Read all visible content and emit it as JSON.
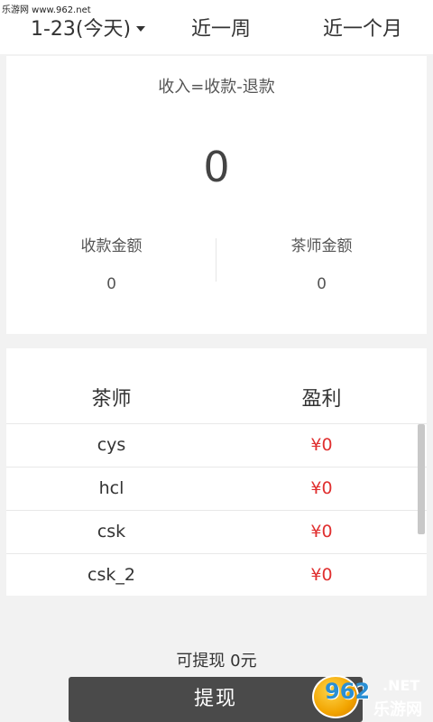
{
  "watermark_top": "乐游网 www.962.net",
  "tabs": {
    "today": "1-23(今天)",
    "week": "近一周",
    "month": "近一个月"
  },
  "summary": {
    "formula": "收入=收款-退款",
    "total": "0",
    "received_label": "收款金额",
    "received_value": "0",
    "tea_master_label": "茶师金额",
    "tea_master_value": "0"
  },
  "profit_table": {
    "col_name": "茶师",
    "col_profit": "盈利",
    "rows": [
      {
        "name": "cys",
        "profit": "¥0"
      },
      {
        "name": "hcl",
        "profit": "¥0"
      },
      {
        "name": "csk",
        "profit": "¥0"
      },
      {
        "name": "csk_2",
        "profit": "¥0"
      }
    ]
  },
  "withdraw": {
    "available": "可提现 0元",
    "button": "提现"
  },
  "logo": {
    "brand": "962",
    "domain": ".NET",
    "sub": "乐游网"
  },
  "colors": {
    "profit": "#e03030",
    "button_bg": "#4a4a4a"
  }
}
